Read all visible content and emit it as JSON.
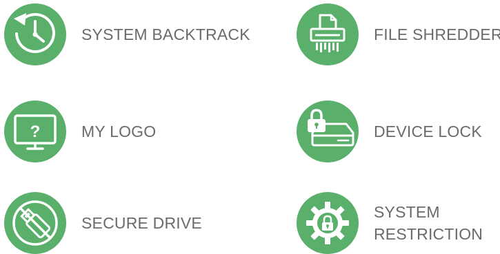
{
  "features": [
    {
      "id": "system-backtrack",
      "icon": "clock-history-icon",
      "label": "SYSTEM BACKTRACK"
    },
    {
      "id": "file-shredder",
      "icon": "shredder-icon",
      "label": "FILE SHREDDER"
    },
    {
      "id": "my-logo",
      "icon": "monitor-question-icon",
      "label": "MY LOGO"
    },
    {
      "id": "device-lock",
      "icon": "drive-lock-icon",
      "label": "DEVICE LOCK"
    },
    {
      "id": "secure-drive",
      "icon": "usb-blocked-icon",
      "label": "SECURE DRIVE"
    },
    {
      "id": "system-restriction",
      "icon": "gear-lock-icon",
      "label_lines": [
        "SYSTEM",
        "RESTRICTION"
      ]
    }
  ],
  "colors": {
    "icon_bg": "#5aaf6a",
    "icon_fg": "#ffffff",
    "label": "#6a6a6a"
  }
}
